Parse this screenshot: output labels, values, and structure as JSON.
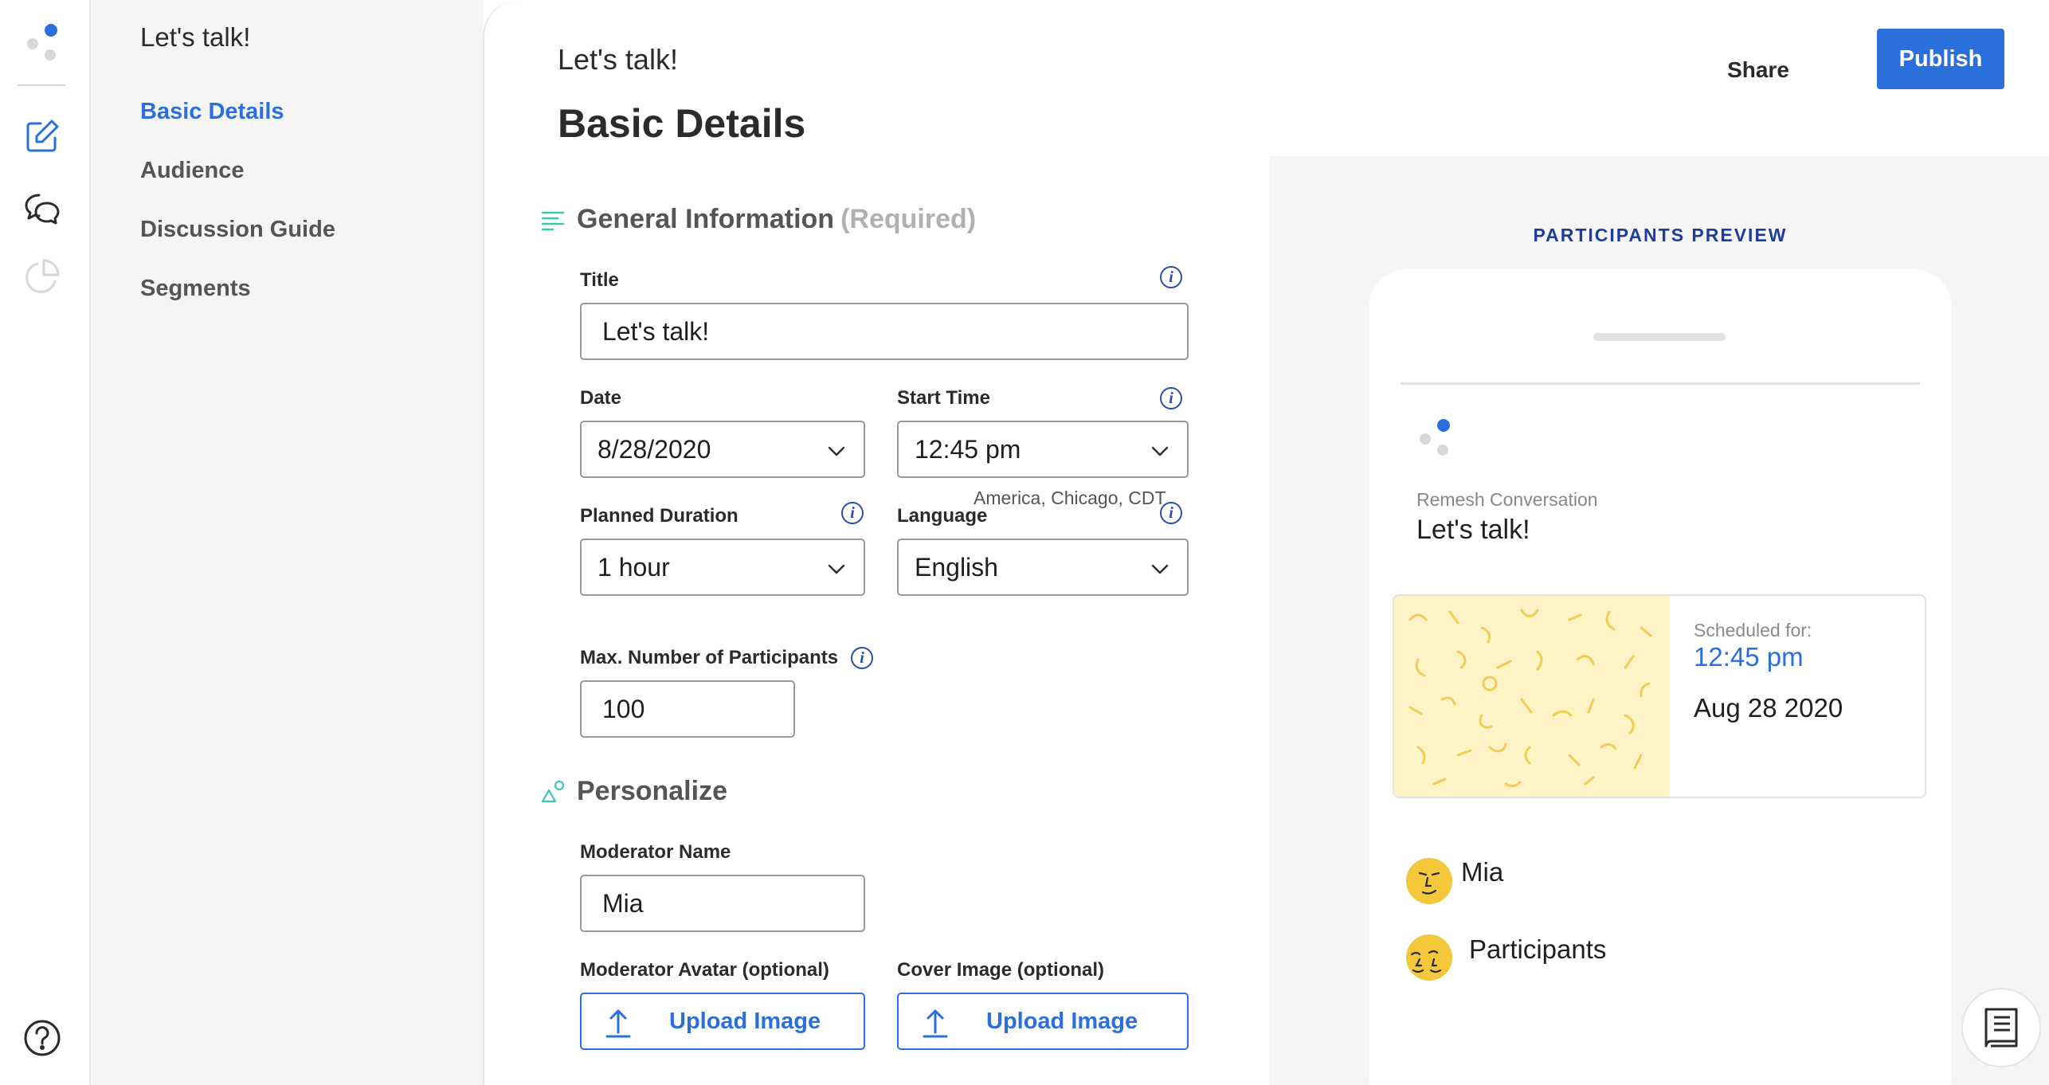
{
  "colors": {
    "accent": "#2a6fdb",
    "teal_icon": "#3cc7b0",
    "navy_text": "#1f3c9c",
    "pattern_bg": "#fdf3c7",
    "pattern_stroke": "#f2cc55"
  },
  "rail": {
    "icons": [
      "logo-icon",
      "edit-icon",
      "chat-icon",
      "pie-chart-icon",
      "help-icon"
    ]
  },
  "nav": {
    "title": "Let's talk!",
    "items": [
      {
        "label": "Basic Details",
        "active": true
      },
      {
        "label": "Audience",
        "active": false
      },
      {
        "label": "Discussion Guide",
        "active": false
      },
      {
        "label": "Segments",
        "active": false
      }
    ]
  },
  "header": {
    "subtitle": "Let's talk!",
    "title": "Basic Details",
    "share_label": "Share",
    "publish_label": "Publish"
  },
  "general": {
    "heading": "General Information",
    "required": "(Required)",
    "title_label": "Title",
    "title_value": "Let's talk!",
    "date_label": "Date",
    "date_value": "8/28/2020",
    "start_time_label": "Start Time",
    "start_time_value": "12:45 pm",
    "timezone": "America, Chicago, CDT",
    "duration_label": "Planned Duration",
    "duration_value": "1 hour",
    "language_label": "Language",
    "language_value": "English",
    "max_participants_label": "Max. Number of Participants",
    "max_participants_value": "100"
  },
  "personalize": {
    "heading": "Personalize",
    "moderator_name_label": "Moderator Name",
    "moderator_name_value": "Mia",
    "avatar_label": "Moderator Avatar (optional)",
    "cover_label": "Cover Image (optional)",
    "upload_label": "Upload Image"
  },
  "preview": {
    "title": "PARTICIPANTS PREVIEW",
    "conversation_label": "Remesh Conversation",
    "conversation_title": "Let's talk!",
    "scheduled_label": "Scheduled for:",
    "scheduled_time": "12:45 pm",
    "scheduled_date": "Aug 28 2020",
    "moderator": "Mia",
    "participants": "Participants"
  }
}
